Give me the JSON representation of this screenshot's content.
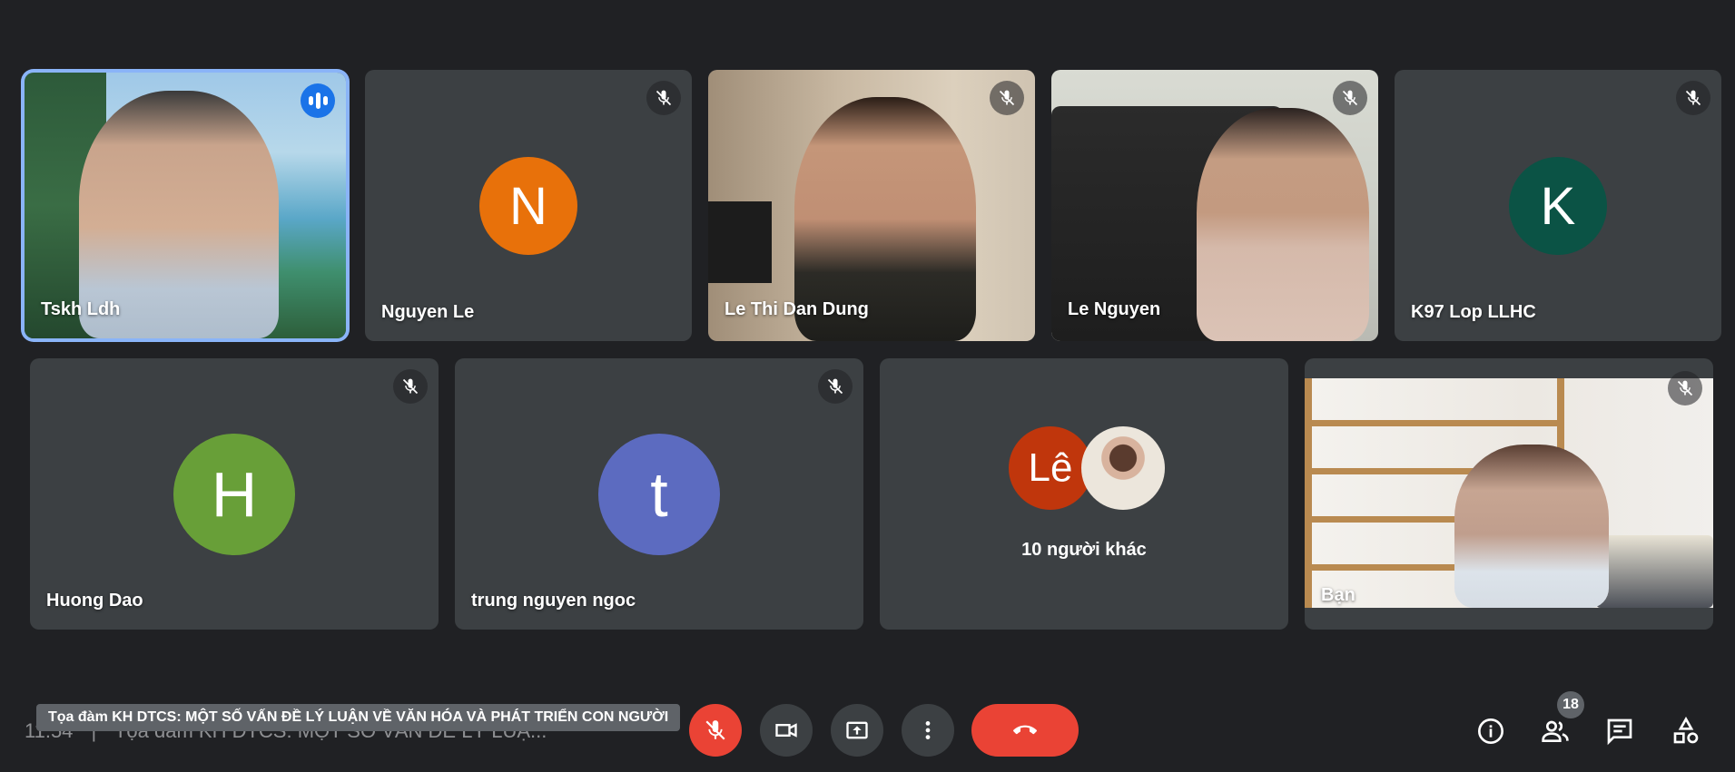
{
  "participants_row1": [
    {
      "name": "Tskh Ldh",
      "speaking": true
    },
    {
      "name": "Nguyen Le",
      "initial": "N",
      "color": "#e8710a"
    },
    {
      "name": "Le Thi Dan Dung"
    },
    {
      "name": "Le Nguyen"
    },
    {
      "name": "K97 Lop LLHC",
      "initial": "K",
      "color": "#0b5345"
    }
  ],
  "participants_row2": [
    {
      "name": "Huong Dao",
      "initial": "H",
      "color": "#689f38"
    },
    {
      "name": "trung nguyen ngoc",
      "initial": "t",
      "color": "#5c6bc0"
    },
    {
      "others_label": "10 người khác",
      "initial": "Lê",
      "color": "#c0360c"
    },
    {
      "name": "Bạn"
    }
  ],
  "meeting": {
    "time": "11:54",
    "title_short": "Tọa đàm KH DTCS: MỘT SỐ VẤN ĐỀ LÝ LUẬ...",
    "tooltip": "Tọa đàm KH DTCS: MỘT SỐ VẤN ĐỀ LÝ LUẬN VỀ VĂN HÓA VÀ PHÁT TRIỂN CON NGƯỜI",
    "separator": "|"
  },
  "controls": {
    "people_count": "18",
    "icons": [
      "mic-off-icon",
      "camera-icon",
      "present-icon",
      "more-icon",
      "hangup-icon"
    ],
    "right_icons": [
      "info-icon",
      "people-icon",
      "chat-icon",
      "activities-icon"
    ]
  },
  "colors": {
    "background": "#202124",
    "tile": "#3c4043",
    "accent": "#8ab4f8",
    "danger": "#ea4335"
  }
}
